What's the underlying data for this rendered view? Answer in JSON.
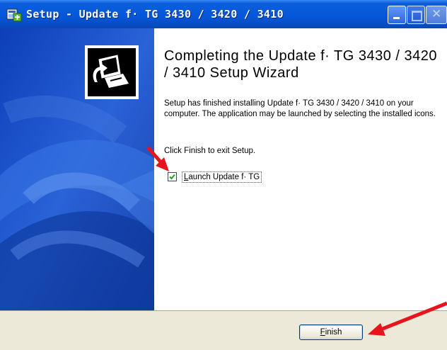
{
  "window": {
    "title": "Setup - Update f· TG 3430 / 3420 / 3410",
    "controls": {
      "minimize_icon": "minimize-icon",
      "maximize_icon": "maximize-icon",
      "close_icon": "close-icon"
    },
    "app_icon": "setup-app-icon"
  },
  "wizard": {
    "heading": "Completing the Update f· TG 3430 / 3420 / 3410 Setup Wizard",
    "description": "Setup has finished installing Update f· TG 3430 / 3420 / 3410 on your computer. The application may be launched by selecting the installed icons.",
    "exit_text": "Click Finish to exit Setup.",
    "launch_checkbox": {
      "mnemonic": "L",
      "label_rest": "aunch Update f· TG",
      "checked": true
    }
  },
  "footer": {
    "finish_mnemonic": "F",
    "finish_rest": "inish"
  },
  "colors": {
    "titlebar": "#0656d8",
    "sidebar": "#1a4fc8",
    "annotation_arrow": "#e8141c",
    "footer": "#ece9d8"
  },
  "annotations": [
    "red-arrow-to-checkbox",
    "red-arrow-to-finish"
  ]
}
